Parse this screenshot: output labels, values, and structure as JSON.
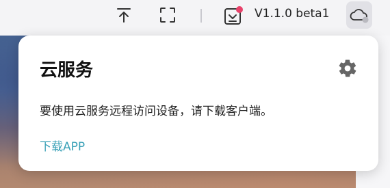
{
  "toolbar": {
    "version_label": "V1.1.0 beta1",
    "icons": {
      "pin_top": "pin-top-icon",
      "fullscreen": "fullscreen-icon",
      "download_notice": "download-notification-icon",
      "cloud": "cloud-icon"
    },
    "notification_dot_color": "#e8416a"
  },
  "popover": {
    "title": "云服务",
    "message": "要使用云服务远程访问设备，请下载客户端。",
    "link_label": "下载APP",
    "link_color": "#3aa1b7"
  }
}
